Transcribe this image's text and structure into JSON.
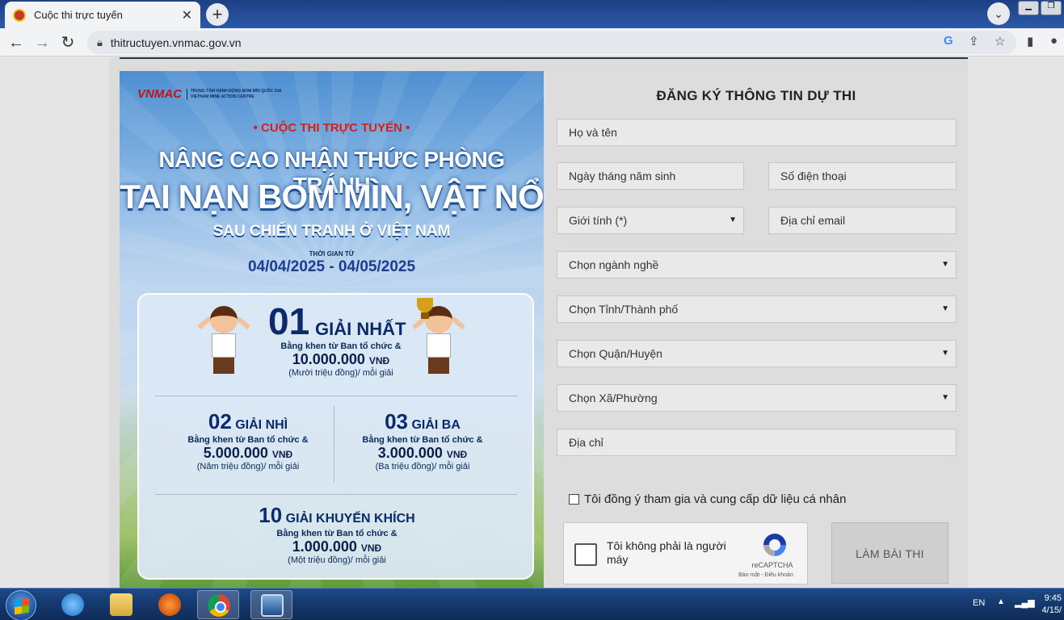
{
  "browser": {
    "tab_title": "Cuộc thi trực tuyến",
    "tab_close": "✕",
    "new_tab": "+",
    "url": "thitructuyen.vnmac.gov.vn"
  },
  "banner": {
    "logo": "VNMAC",
    "logo_line1": "TRUNG TÂM HÀNH ĐỘNG BOM MÌN QUỐC GIA",
    "logo_line2": "VIETNAM MINE ACTION CENTRE",
    "contest_label": "• CUỘC THI TRỰC TUYẾN •",
    "headline1": "NÂNG CAO NHẬN THỨC PHÒNG TRÁNH",
    "headline2": "TAI NẠN BOM MÌN, VẬT NỔ",
    "headline3": "SAU CHIẾN TRANH Ở VIỆT NAM",
    "time_label": "THỜI GIAN TỪ",
    "date_range": "04/04/2025 - 04/05/2025",
    "prizes": {
      "first": {
        "num": "01",
        "title": "GIẢI NHẤT",
        "desc": "Bằng khen từ Ban tổ chức &",
        "amount": "10.000.000",
        "currency": "VNĐ",
        "words": "(Mười triệu đồng)/ mỗi giải"
      },
      "second": {
        "num": "02",
        "title": "GIẢI NHÌ",
        "desc": "Bằng khen từ Ban tổ chức &",
        "amount": "5.000.000",
        "currency": "VNĐ",
        "words": "(Năm triệu đồng)/ mỗi giải"
      },
      "third": {
        "num": "03",
        "title": "GIẢI BA",
        "desc": "Bằng khen từ Ban tổ chức &",
        "amount": "3.000.000",
        "currency": "VNĐ",
        "words": "(Ba triệu đồng)/ mỗi giải"
      },
      "encourage": {
        "num": "10",
        "title": "GIẢI KHUYẾN KHÍCH",
        "desc": "Bằng khen từ Ban tổ chức &",
        "amount": "1.000.000",
        "currency": "VNĐ",
        "words": "(Một triệu đồng)/ mỗi giải"
      }
    }
  },
  "form": {
    "title": "ĐĂNG KÝ THÔNG TIN DỰ THI",
    "full_name": "Họ và tên",
    "dob": "Ngày tháng năm sinh",
    "phone": "Số điện thoại",
    "gender": "Giới tính (*)",
    "email": "Địa chỉ email",
    "occupation": "Chọn ngành nghề",
    "province": "Chọn Tỉnh/Thành phố",
    "district": "Chọn Quận/Huyện",
    "ward": "Chọn Xã/Phường",
    "address": "Địa chỉ",
    "consent": "Tôi đồng ý tham gia và cung cấp dữ liệu cá nhân",
    "recaptcha_label": "Tôi không phải là người máy",
    "recaptcha_brand": "reCAPTCHA",
    "recaptcha_links": "Bảo mật - Điều khoản",
    "submit": "LÀM BÀI THI"
  },
  "taskbar": {
    "lang": "EN",
    "time": "9:45",
    "date": "4/15/"
  }
}
